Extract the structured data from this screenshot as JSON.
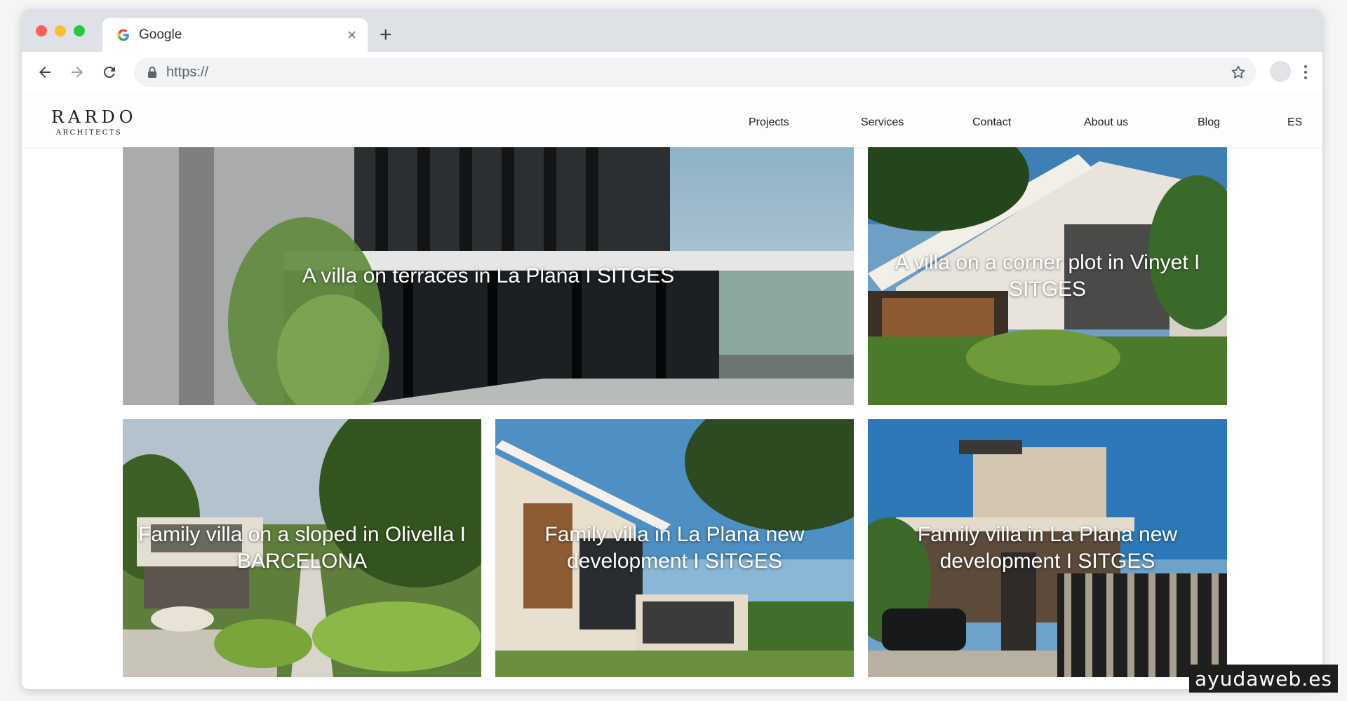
{
  "browser": {
    "tab_title": "Google",
    "tab_close": "×",
    "new_tab": "+",
    "url": "https://",
    "icons": [
      "google-g-icon",
      "close-icon",
      "plus-icon",
      "back-arrow-icon",
      "forward-arrow-icon",
      "reload-icon",
      "lock-icon",
      "star-icon",
      "menu-dots-icon"
    ]
  },
  "site": {
    "logo_main": "RARDO",
    "logo_sub": "ARCHITECTS",
    "nav": [
      "Projects",
      "Services",
      "Contact",
      "About us",
      "Blog",
      "ES"
    ]
  },
  "projects": [
    {
      "caption": "A villa on terraces in La Plana I SITGES"
    },
    {
      "caption": "A villa on a corner plot in Vinyet I SITGES"
    },
    {
      "caption": "Family villa on a sloped in Olivella I BARCELONA"
    },
    {
      "caption": "Family villa in La Plana new development I SITGES"
    },
    {
      "caption": "Family villa in La Plana new development I SITGES"
    }
  ],
  "watermark": "ayudaweb.es",
  "colors": {
    "tabbar": "#dee1e6",
    "omnibox": "#f1f3f4",
    "header_bg": "#fdfdfb",
    "caption_text": "#ffffff"
  }
}
